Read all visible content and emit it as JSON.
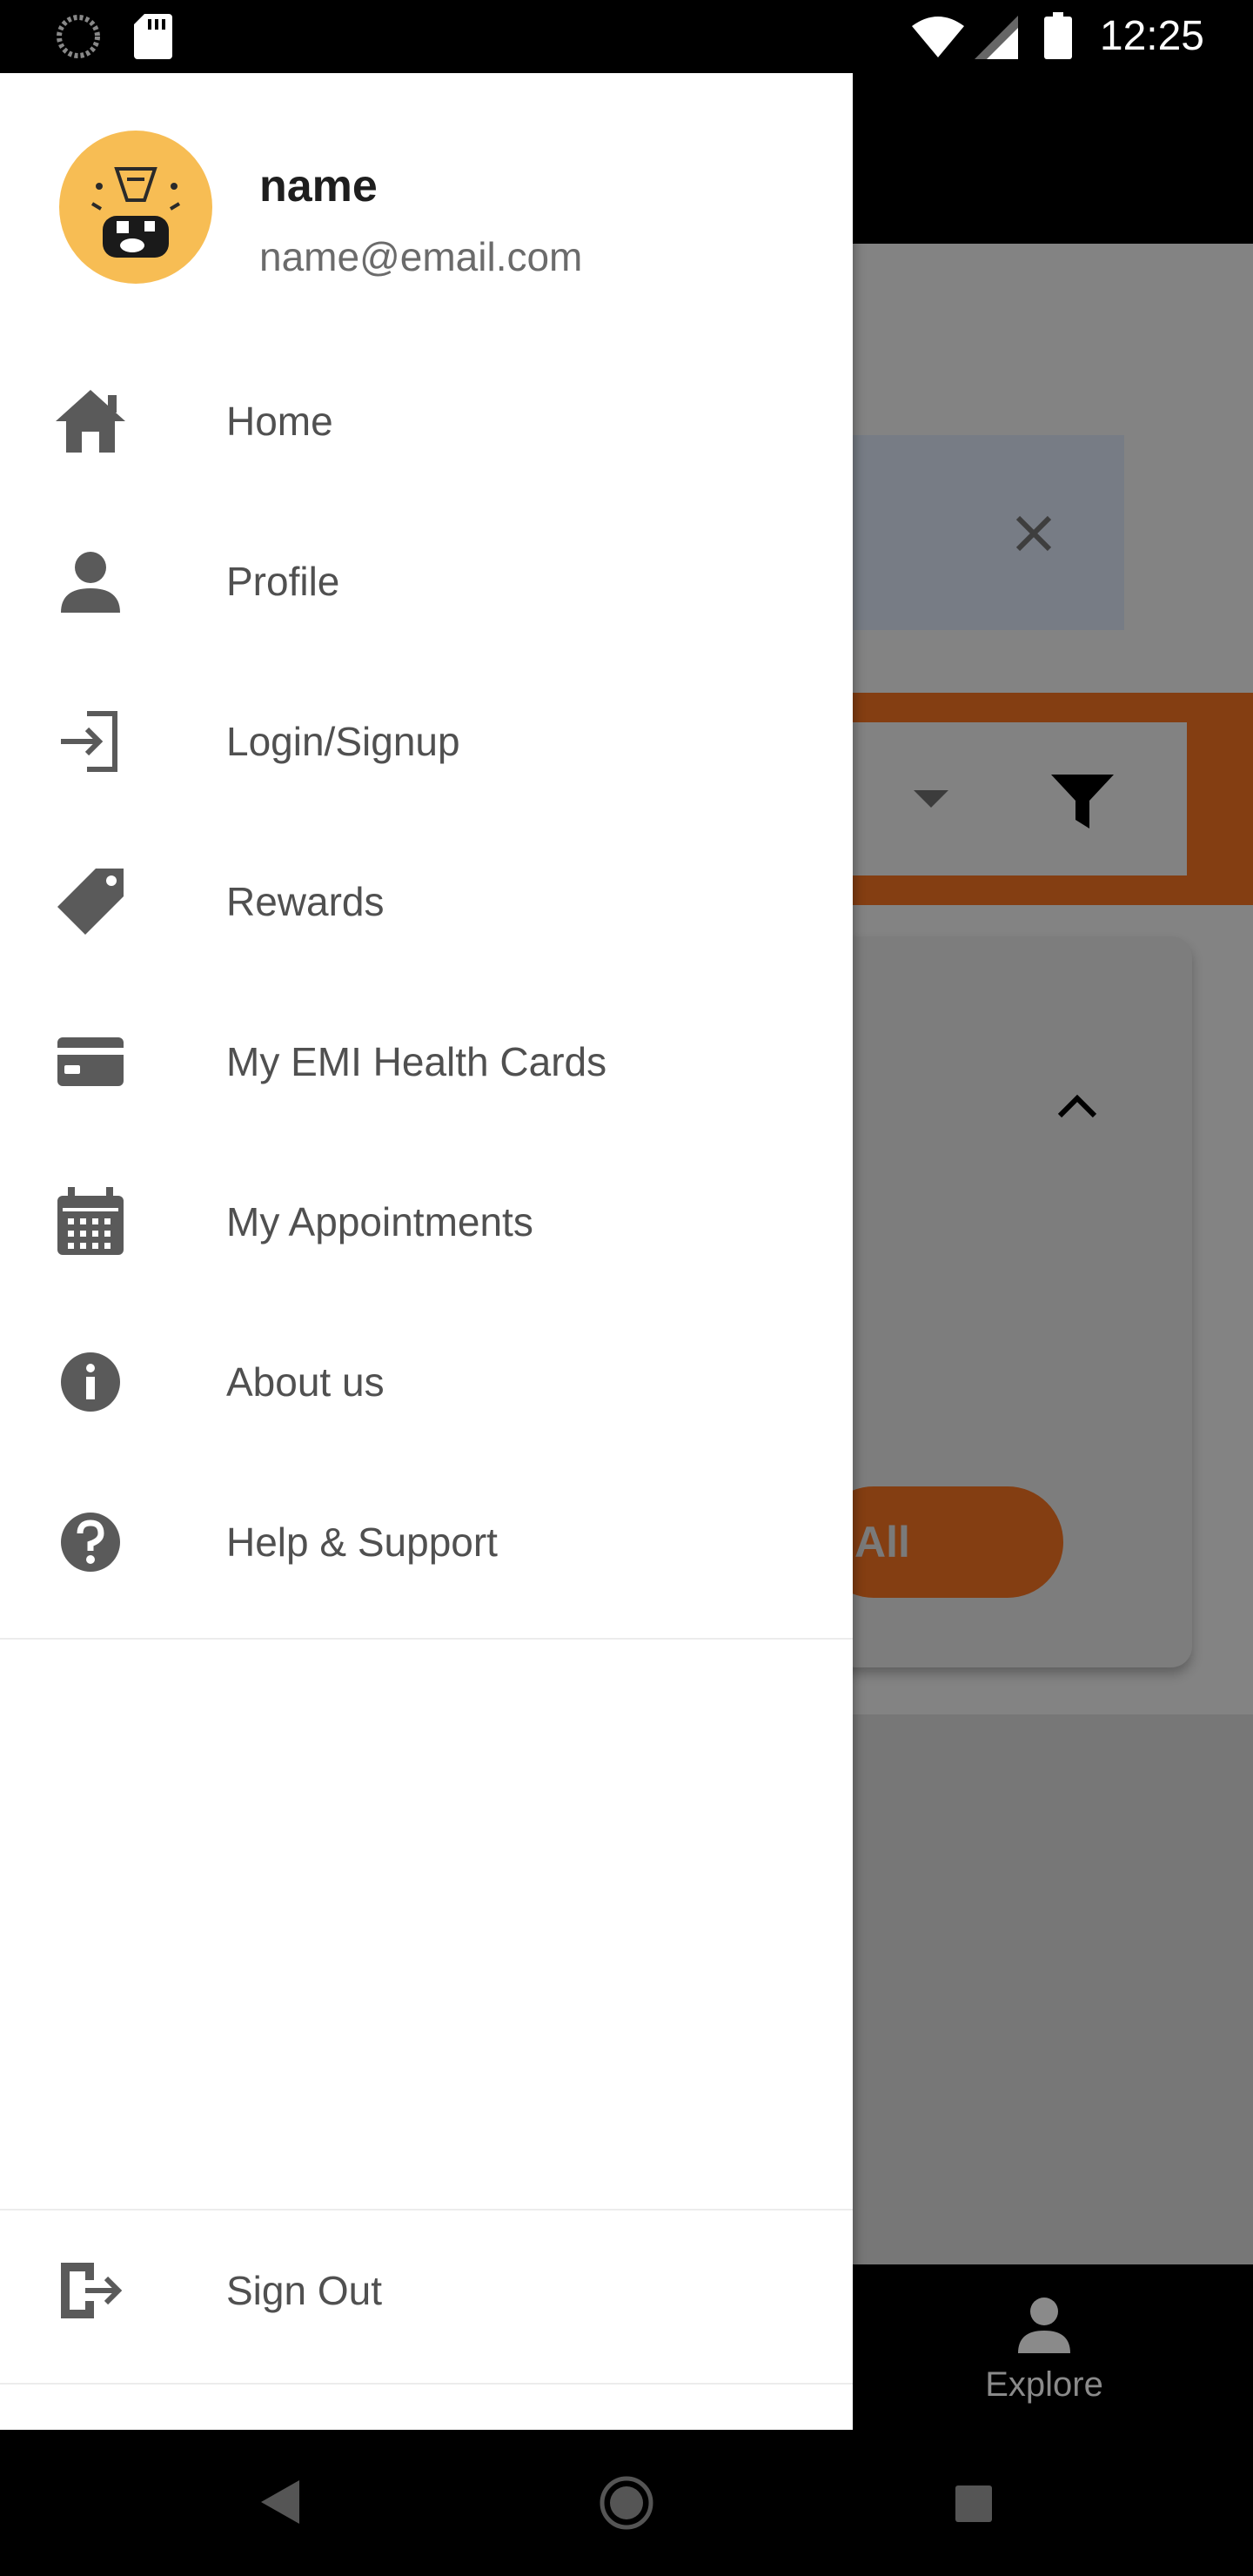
{
  "status_bar": {
    "time": "12:25"
  },
  "drawer": {
    "user": {
      "name": "name",
      "email": "name@email.com"
    },
    "items": [
      {
        "label": "Home",
        "icon": "home-icon"
      },
      {
        "label": "Profile",
        "icon": "person-icon"
      },
      {
        "label": "Login/Signup",
        "icon": "login-icon"
      },
      {
        "label": "Rewards",
        "icon": "tag-icon"
      },
      {
        "label": "My EMI Health Cards",
        "icon": "card-icon"
      },
      {
        "label": "My Appointments",
        "icon": "calendar-icon"
      },
      {
        "label": "About us",
        "icon": "info-icon"
      },
      {
        "label": "Help & Support",
        "icon": "help-icon"
      }
    ],
    "sign_out": {
      "label": "Sign Out",
      "icon": "sign-out-icon"
    }
  },
  "background": {
    "all_button": "All",
    "bottom_nav": {
      "explore_label": "Explore"
    }
  },
  "colors": {
    "accent": "#843e12",
    "avatar": "#f7bd54",
    "icon": "#5a5a5a",
    "text": "#505050"
  }
}
